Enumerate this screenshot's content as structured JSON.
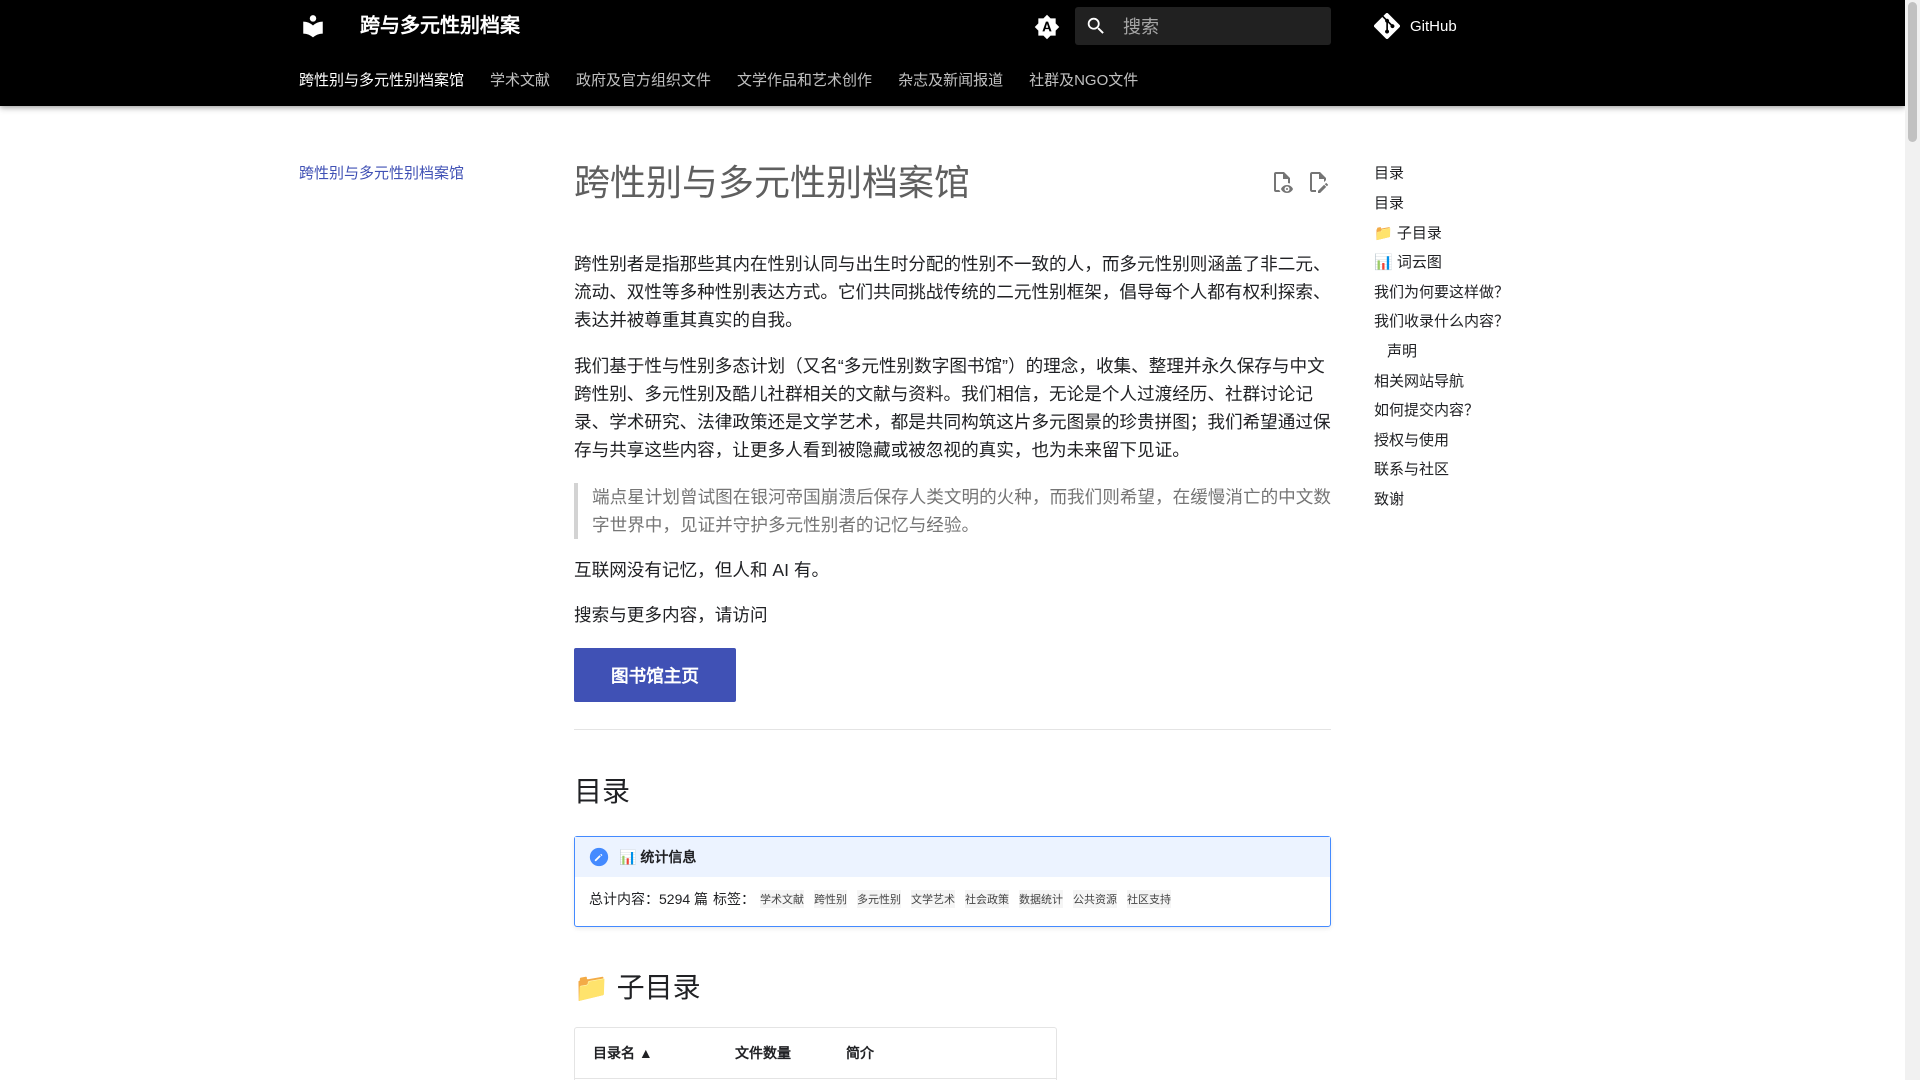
{
  "header": {
    "site_title": "跨与多元性别档案",
    "search_placeholder": "搜索",
    "repo_label": "GitHub",
    "tabs": [
      {
        "label": "跨性别与多元性别档案馆"
      },
      {
        "label": "学术文献"
      },
      {
        "label": "政府及官方组织文件"
      },
      {
        "label": "文学作品和艺术创作"
      },
      {
        "label": "杂志及新闻报道"
      },
      {
        "label": "社群及NGO文件"
      }
    ]
  },
  "left_nav": {
    "active_item": "跨性别与多元性别档案馆"
  },
  "content": {
    "title": "跨性别与多元性别档案馆",
    "p1": "跨性别者是指那些其内在性别认同与出生时分配的性别不一致的人，而多元性别则涵盖了非二元、流动、双性等多种性别表达方式。它们共同挑战传统的二元性别框架，倡导每个人都有权利探索、表达并被尊重其真实的自我。",
    "p2": "我们基于性与性别多态计划（又名“多元性别数字图书馆”）的理念，收集、整理并永久保存与中文跨性别、多元性别及酷儿社群相关的文献与资料。我们相信，无论是个人过渡经历、社群讨论记录、学术研究、法律政策还是文学艺术，都是共同构筑这片多元图景的珍贵拼图；我们希望通过保存与共享这些内容，让更多人看到被隐藏或被忽视的真实，也为未来留下见证。",
    "quote": "端点星计划曾试图在银河帝国崩溃后保存人类文明的火种，而我们则希望，在缓慢消亡的中文数字世界中，见证并守护多元性别者的记忆与经验。",
    "p3": "互联网没有记忆，但人和 AI 有。",
    "p4": "搜索与更多内容，请访问",
    "button_label": "图书馆主页",
    "toc_heading": "目录",
    "admonition": {
      "title": "📊 统计信息",
      "total_label": "总计内容：5294 篇",
      "tags_label": "标签：",
      "tags": [
        "学术文献",
        "跨性别",
        "多元性别",
        "文学艺术",
        "社会政策",
        "数据统计",
        "公共资源",
        "社区支持"
      ]
    },
    "sub_heading": "📁 子目录",
    "table_headers": [
      "目录名 ▲",
      "文件数量",
      "简介"
    ]
  },
  "toc": {
    "title": "目录",
    "items": [
      {
        "label": "目录",
        "sub": false
      },
      {
        "label": "📁 子目录",
        "sub": false
      },
      {
        "label": "📊 词云图",
        "sub": false
      },
      {
        "label": "我们为何要这样做？",
        "sub": false
      },
      {
        "label": "我们收录什么内容？",
        "sub": false
      },
      {
        "label": "声明",
        "sub": true
      },
      {
        "label": "相关网站导航",
        "sub": false
      },
      {
        "label": "如何提交内容？",
        "sub": false
      },
      {
        "label": "授权与使用",
        "sub": false
      },
      {
        "label": "联系与社区",
        "sub": false
      },
      {
        "label": "致谢",
        "sub": false
      }
    ]
  },
  "colors": {
    "header_bg": "#000000",
    "accent": "#4051b5",
    "admonition_border": "#448aff",
    "admonition_bg": "#ecf3ff"
  },
  "icons": [
    "book-logo-icon",
    "palette-toggle-icon",
    "search-icon",
    "git-icon",
    "view-source-icon",
    "edit-page-icon",
    "pencil-icon"
  ]
}
